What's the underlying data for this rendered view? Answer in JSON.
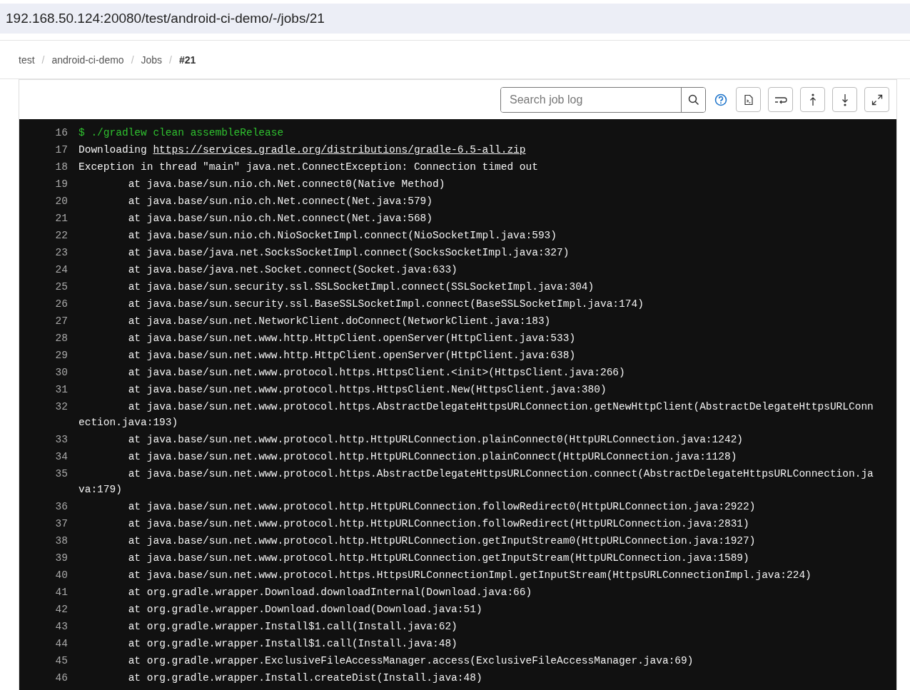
{
  "address_bar": {
    "url": "192.168.50.124:20080/test/android-ci-demo/-/jobs/21"
  },
  "breadcrumb": [
    {
      "label": "test",
      "current": false
    },
    {
      "label": "android-ci-demo",
      "current": false
    },
    {
      "label": "Jobs",
      "current": false
    },
    {
      "label": "#21",
      "current": true
    }
  ],
  "breadcrumb_separator": "/",
  "search": {
    "placeholder": "Search job log"
  },
  "log_lines": [
    {
      "number": "16",
      "segments": [
        {
          "kind": "command",
          "text": "$ ./gradlew clean assembleRelease"
        }
      ]
    },
    {
      "number": "17",
      "segments": [
        {
          "kind": "plain",
          "text": "Downloading "
        },
        {
          "kind": "link",
          "text": "https://services.gradle.org/distributions/gradle-6.5-all.zip"
        }
      ]
    },
    {
      "number": "18",
      "segments": [
        {
          "kind": "plain",
          "text": "Exception in thread \"main\" java.net.ConnectException: Connection timed out"
        }
      ]
    },
    {
      "number": "19",
      "segments": [
        {
          "kind": "plain",
          "text": "        at java.base/sun.nio.ch.Net.connect0(Native Method)"
        }
      ]
    },
    {
      "number": "20",
      "segments": [
        {
          "kind": "plain",
          "text": "        at java.base/sun.nio.ch.Net.connect(Net.java:579)"
        }
      ]
    },
    {
      "number": "21",
      "segments": [
        {
          "kind": "plain",
          "text": "        at java.base/sun.nio.ch.Net.connect(Net.java:568)"
        }
      ]
    },
    {
      "number": "22",
      "segments": [
        {
          "kind": "plain",
          "text": "        at java.base/sun.nio.ch.NioSocketImpl.connect(NioSocketImpl.java:593)"
        }
      ]
    },
    {
      "number": "23",
      "segments": [
        {
          "kind": "plain",
          "text": "        at java.base/java.net.SocksSocketImpl.connect(SocksSocketImpl.java:327)"
        }
      ]
    },
    {
      "number": "24",
      "segments": [
        {
          "kind": "plain",
          "text": "        at java.base/java.net.Socket.connect(Socket.java:633)"
        }
      ]
    },
    {
      "number": "25",
      "segments": [
        {
          "kind": "plain",
          "text": "        at java.base/sun.security.ssl.SSLSocketImpl.connect(SSLSocketImpl.java:304)"
        }
      ]
    },
    {
      "number": "26",
      "segments": [
        {
          "kind": "plain",
          "text": "        at java.base/sun.security.ssl.BaseSSLSocketImpl.connect(BaseSSLSocketImpl.java:174)"
        }
      ]
    },
    {
      "number": "27",
      "segments": [
        {
          "kind": "plain",
          "text": "        at java.base/sun.net.NetworkClient.doConnect(NetworkClient.java:183)"
        }
      ]
    },
    {
      "number": "28",
      "segments": [
        {
          "kind": "plain",
          "text": "        at java.base/sun.net.www.http.HttpClient.openServer(HttpClient.java:533)"
        }
      ]
    },
    {
      "number": "29",
      "segments": [
        {
          "kind": "plain",
          "text": "        at java.base/sun.net.www.http.HttpClient.openServer(HttpClient.java:638)"
        }
      ]
    },
    {
      "number": "30",
      "segments": [
        {
          "kind": "plain",
          "text": "        at java.base/sun.net.www.protocol.https.HttpsClient.<init>(HttpsClient.java:266)"
        }
      ]
    },
    {
      "number": "31",
      "segments": [
        {
          "kind": "plain",
          "text": "        at java.base/sun.net.www.protocol.https.HttpsClient.New(HttpsClient.java:380)"
        }
      ]
    },
    {
      "number": "32",
      "segments": [
        {
          "kind": "plain",
          "text": "        at java.base/sun.net.www.protocol.https.AbstractDelegateHttpsURLConnection.getNewHttpClient(AbstractDelegateHttpsURLConnection.java:193)"
        }
      ]
    },
    {
      "number": "33",
      "segments": [
        {
          "kind": "plain",
          "text": "        at java.base/sun.net.www.protocol.http.HttpURLConnection.plainConnect0(HttpURLConnection.java:1242)"
        }
      ]
    },
    {
      "number": "34",
      "segments": [
        {
          "kind": "plain",
          "text": "        at java.base/sun.net.www.protocol.http.HttpURLConnection.plainConnect(HttpURLConnection.java:1128)"
        }
      ]
    },
    {
      "number": "35",
      "segments": [
        {
          "kind": "plain",
          "text": "        at java.base/sun.net.www.protocol.https.AbstractDelegateHttpsURLConnection.connect(AbstractDelegateHttpsURLConnection.java:179)"
        }
      ]
    },
    {
      "number": "36",
      "segments": [
        {
          "kind": "plain",
          "text": "        at java.base/sun.net.www.protocol.http.HttpURLConnection.followRedirect0(HttpURLConnection.java:2922)"
        }
      ]
    },
    {
      "number": "37",
      "segments": [
        {
          "kind": "plain",
          "text": "        at java.base/sun.net.www.protocol.http.HttpURLConnection.followRedirect(HttpURLConnection.java:2831)"
        }
      ]
    },
    {
      "number": "38",
      "segments": [
        {
          "kind": "plain",
          "text": "        at java.base/sun.net.www.protocol.http.HttpURLConnection.getInputStream0(HttpURLConnection.java:1927)"
        }
      ]
    },
    {
      "number": "39",
      "segments": [
        {
          "kind": "plain",
          "text": "        at java.base/sun.net.www.protocol.http.HttpURLConnection.getInputStream(HttpURLConnection.java:1589)"
        }
      ]
    },
    {
      "number": "40",
      "segments": [
        {
          "kind": "plain",
          "text": "        at java.base/sun.net.www.protocol.https.HttpsURLConnectionImpl.getInputStream(HttpsURLConnectionImpl.java:224)"
        }
      ]
    },
    {
      "number": "41",
      "segments": [
        {
          "kind": "plain",
          "text": "        at org.gradle.wrapper.Download.downloadInternal(Download.java:66)"
        }
      ]
    },
    {
      "number": "42",
      "segments": [
        {
          "kind": "plain",
          "text": "        at org.gradle.wrapper.Download.download(Download.java:51)"
        }
      ]
    },
    {
      "number": "43",
      "segments": [
        {
          "kind": "plain",
          "text": "        at org.gradle.wrapper.Install$1.call(Install.java:62)"
        }
      ]
    },
    {
      "number": "44",
      "segments": [
        {
          "kind": "plain",
          "text": "        at org.gradle.wrapper.Install$1.call(Install.java:48)"
        }
      ]
    },
    {
      "number": "45",
      "segments": [
        {
          "kind": "plain",
          "text": "        at org.gradle.wrapper.ExclusiveFileAccessManager.access(ExclusiveFileAccessManager.java:69)"
        }
      ]
    },
    {
      "number": "46",
      "segments": [
        {
          "kind": "plain",
          "text": "        at org.gradle.wrapper.Install.createDist(Install.java:48)"
        }
      ]
    }
  ]
}
